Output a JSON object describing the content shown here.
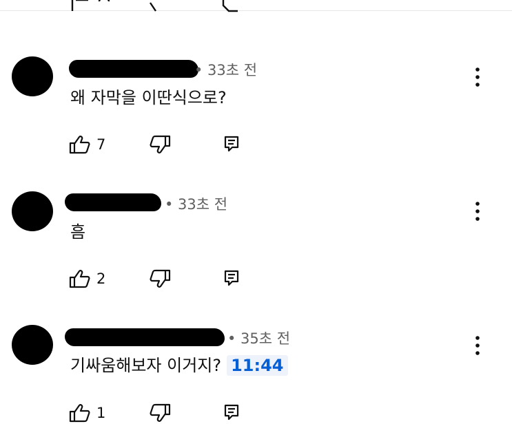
{
  "comments": [
    {
      "time": "• 33초 전",
      "text": "왜 자막을 이딴식으로?",
      "likes": "7"
    },
    {
      "time": "• 33초 전",
      "text": "흠",
      "likes": "2"
    },
    {
      "time": "• 35초 전",
      "text": "기싸움해보자 이거지?",
      "timestamp_link": "11:44",
      "likes": "1"
    }
  ],
  "icons": {
    "like": "thumbs-up-icon",
    "dislike": "thumbs-down-icon",
    "reply": "reply-icon",
    "more": "more-vert-icon"
  },
  "colors": {
    "text": "#0f0f0f",
    "muted": "#606060",
    "link": "#065fd4",
    "link_bg": "#eef3fb"
  }
}
